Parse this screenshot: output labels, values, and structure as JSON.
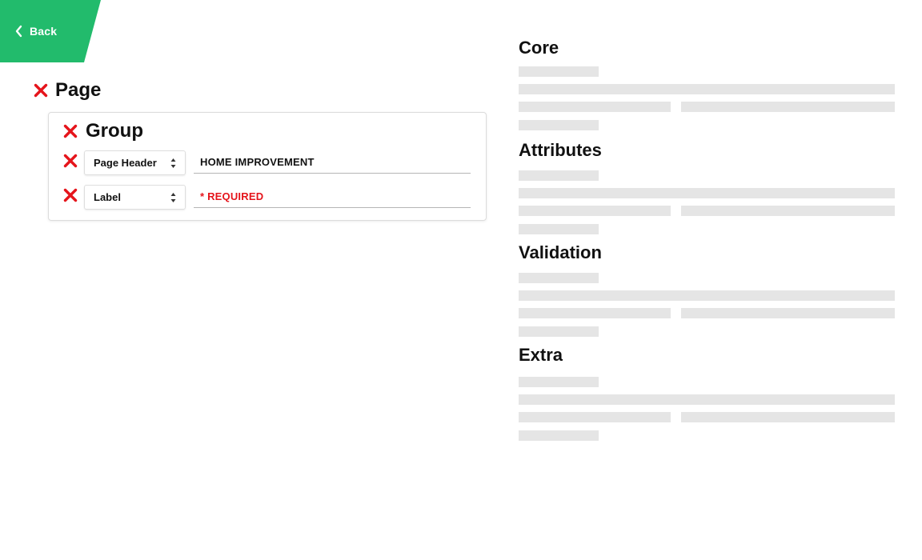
{
  "back": {
    "label": "Back",
    "color": "#22bb6c"
  },
  "tree": {
    "page_title": "Page",
    "group_title": "Group",
    "fields": [
      {
        "type_label": "Page Header",
        "value": "HOME IMPROVEMENT",
        "placeholder": ""
      },
      {
        "type_label": "Label",
        "value": "",
        "placeholder": "* REQUIRED"
      }
    ]
  },
  "sections": [
    {
      "title": "Core"
    },
    {
      "title": "Attributes"
    },
    {
      "title": "Validation"
    },
    {
      "title": "Extra"
    }
  ],
  "colors": {
    "remove_icon": "#e5141b",
    "required_text": "#e5141b",
    "skeleton": "#e5e5e5"
  },
  "icons": {
    "back": "chevron-left-icon",
    "remove": "close-icon",
    "select": "updown-arrows-icon"
  }
}
